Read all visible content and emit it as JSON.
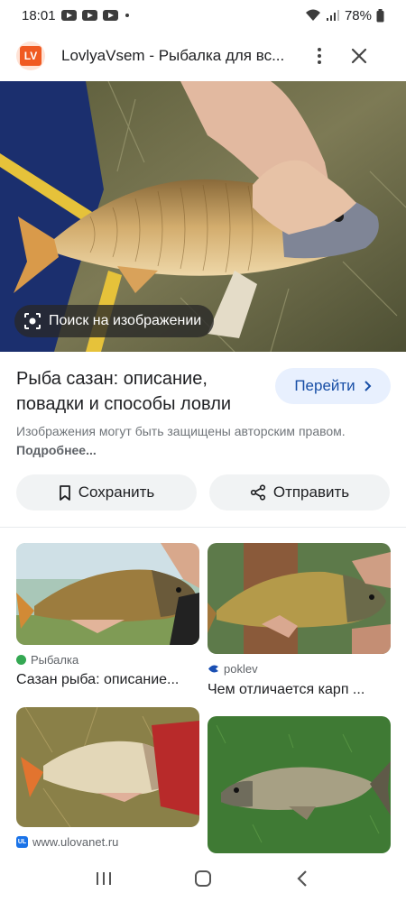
{
  "status_bar": {
    "time": "18:01",
    "battery": "78%"
  },
  "header": {
    "logo_text": "LV",
    "title": "LovlyaVsem - Рыбалка для вс..."
  },
  "hero": {
    "lens_label": "Поиск на изображении"
  },
  "result": {
    "title": "Рыба сазан: описание, повадки и способы ловли",
    "visit_label": "Перейти",
    "copyright_text": "Изображения могут быть защищены авторским правом.",
    "more_link": "Подробнее..."
  },
  "actions": {
    "save_label": "Сохранить",
    "share_label": "Отправить"
  },
  "related": [
    {
      "source": "Рыбалка",
      "title": "Сазан рыба: описание..."
    },
    {
      "source": "poklev",
      "title": "Чем отличается карп ..."
    },
    {
      "source": "www.ulovanet.ru",
      "title": ""
    },
    {
      "source": "",
      "title": ""
    }
  ],
  "colors": {
    "accent_blue": "#174ea6",
    "visit_bg": "#e8f0fe",
    "chip_bg": "#f1f3f4",
    "logo_orange": "#f05a22"
  }
}
